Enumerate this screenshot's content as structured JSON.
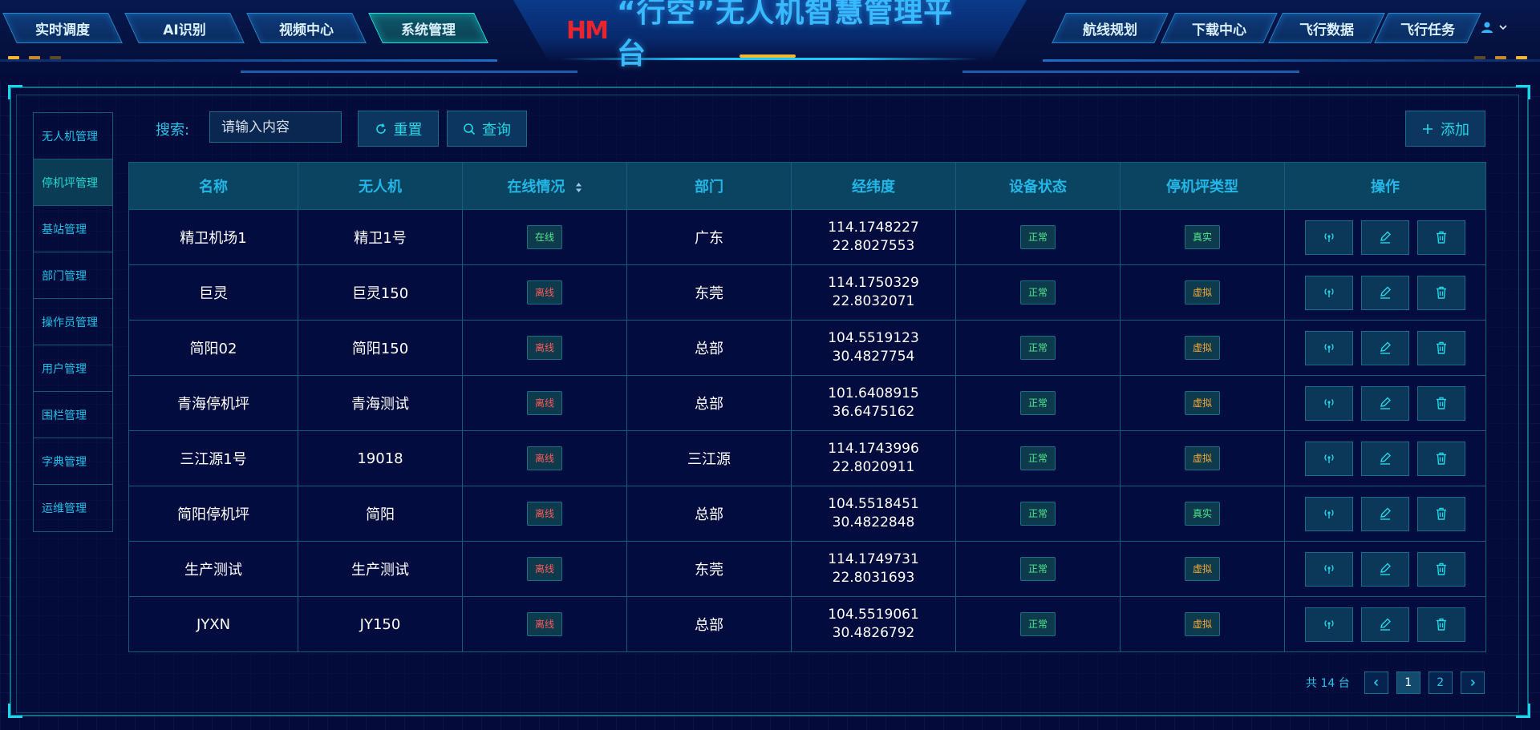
{
  "header": {
    "logo_text": "HM",
    "title": "“行空”无人机智慧管理平台",
    "left_tabs": [
      "实时调度",
      "AI识别",
      "视频中心",
      "系统管理"
    ],
    "right_tabs": [
      "航线规划",
      "下载中心",
      "飞行数据",
      "飞行任务"
    ],
    "active_tab": "系统管理",
    "user_icon": "user-icon",
    "user_menu_icon": "chevron-down-icon",
    "accent_color": "#39b9ff",
    "logo_color": "#e8242d"
  },
  "sidebar": {
    "active": "停机坪管理",
    "items": [
      {
        "label": "无人机管理"
      },
      {
        "label": "停机坪管理"
      },
      {
        "label": "基站管理"
      },
      {
        "label": "部门管理"
      },
      {
        "label": "操作员管理"
      },
      {
        "label": "用户管理"
      },
      {
        "label": "围栏管理"
      },
      {
        "label": "字典管理"
      },
      {
        "label": "运维管理"
      }
    ]
  },
  "toolbar": {
    "search_label": "搜索:",
    "search_placeholder": "请输入内容",
    "search_value": "",
    "reset_label": "重置",
    "query_label": "查询",
    "add_label": "添加"
  },
  "table": {
    "headers": [
      "名称",
      "无人机",
      "在线情况",
      "部门",
      "经纬度",
      "设备状态",
      "停机坪类型",
      "操作"
    ],
    "rows": [
      {
        "name": "精卫机场1",
        "drone": "精卫1号",
        "online": "在线",
        "online_state": "on",
        "dept": "广东",
        "lng": "114.1748227",
        "lat": "22.8027553",
        "status": "正常",
        "type": "真实",
        "type_kind": "real"
      },
      {
        "name": "巨灵",
        "drone": "巨灵150",
        "online": "离线",
        "online_state": "off",
        "dept": "东莞",
        "lng": "114.1750329",
        "lat": "22.8032071",
        "status": "正常",
        "type": "虚拟",
        "type_kind": "virtual"
      },
      {
        "name": "简阳02",
        "drone": "简阳150",
        "online": "离线",
        "online_state": "off",
        "dept": "总部",
        "lng": "104.5519123",
        "lat": "30.4827754",
        "status": "正常",
        "type": "虚拟",
        "type_kind": "virtual"
      },
      {
        "name": "青海停机坪",
        "drone": "青海测试",
        "online": "离线",
        "online_state": "off",
        "dept": "总部",
        "lng": "101.6408915",
        "lat": "36.6475162",
        "status": "正常",
        "type": "虚拟",
        "type_kind": "virtual"
      },
      {
        "name": "三江源1号",
        "drone": "19018",
        "online": "离线",
        "online_state": "off",
        "dept": "三江源",
        "lng": "114.1743996",
        "lat": "22.8020911",
        "status": "正常",
        "type": "虚拟",
        "type_kind": "virtual"
      },
      {
        "name": "简阳停机坪",
        "drone": "简阳",
        "online": "离线",
        "online_state": "off",
        "dept": "总部",
        "lng": "104.5518451",
        "lat": "30.4822848",
        "status": "正常",
        "type": "真实",
        "type_kind": "real"
      },
      {
        "name": "生产测试",
        "drone": "生产测试",
        "online": "离线",
        "online_state": "off",
        "dept": "东莞",
        "lng": "114.1749731",
        "lat": "22.8031693",
        "status": "正常",
        "type": "虚拟",
        "type_kind": "virtual"
      },
      {
        "name": "JYXN",
        "drone": "JY150",
        "online": "离线",
        "online_state": "off",
        "dept": "总部",
        "lng": "104.5519061",
        "lat": "30.4826792",
        "status": "正常",
        "type": "虚拟",
        "type_kind": "virtual"
      }
    ],
    "row_action_icons": [
      "signal-icon",
      "edit-icon",
      "delete-icon"
    ]
  },
  "pagination": {
    "total_text": "共 14 台",
    "pages": [
      "1",
      "2"
    ],
    "current_page": "1"
  }
}
